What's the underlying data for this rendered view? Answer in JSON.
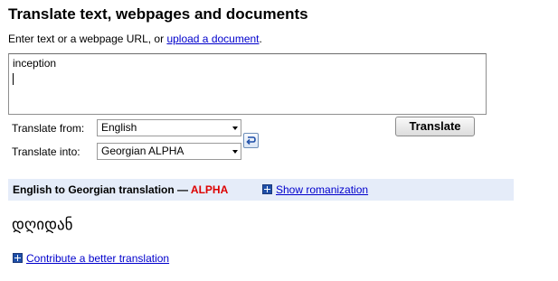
{
  "page": {
    "title": "Translate text, webpages and documents",
    "intro_text": "Enter text or a webpage URL, or ",
    "intro_link": "upload a document",
    "intro_end": "."
  },
  "input": {
    "value": "inception"
  },
  "controls": {
    "from_label": "Translate from:",
    "from_value": "English",
    "into_label": "Translate into:",
    "into_value": "Georgian ALPHA",
    "translate_button": "Translate",
    "swap_icon": "swap-languages-icon"
  },
  "result_header": {
    "title": "English to Georgian translation — ",
    "badge": "ALPHA",
    "romanization_link": "Show romanization",
    "plus_icon": "plus-box-icon"
  },
  "result": {
    "text": "დღიდან"
  },
  "footer": {
    "contribute_link": "Contribute a better translation"
  },
  "colors": {
    "link": "#0000cc",
    "alpha": "#dd0000",
    "band": "#e5ecf9"
  }
}
